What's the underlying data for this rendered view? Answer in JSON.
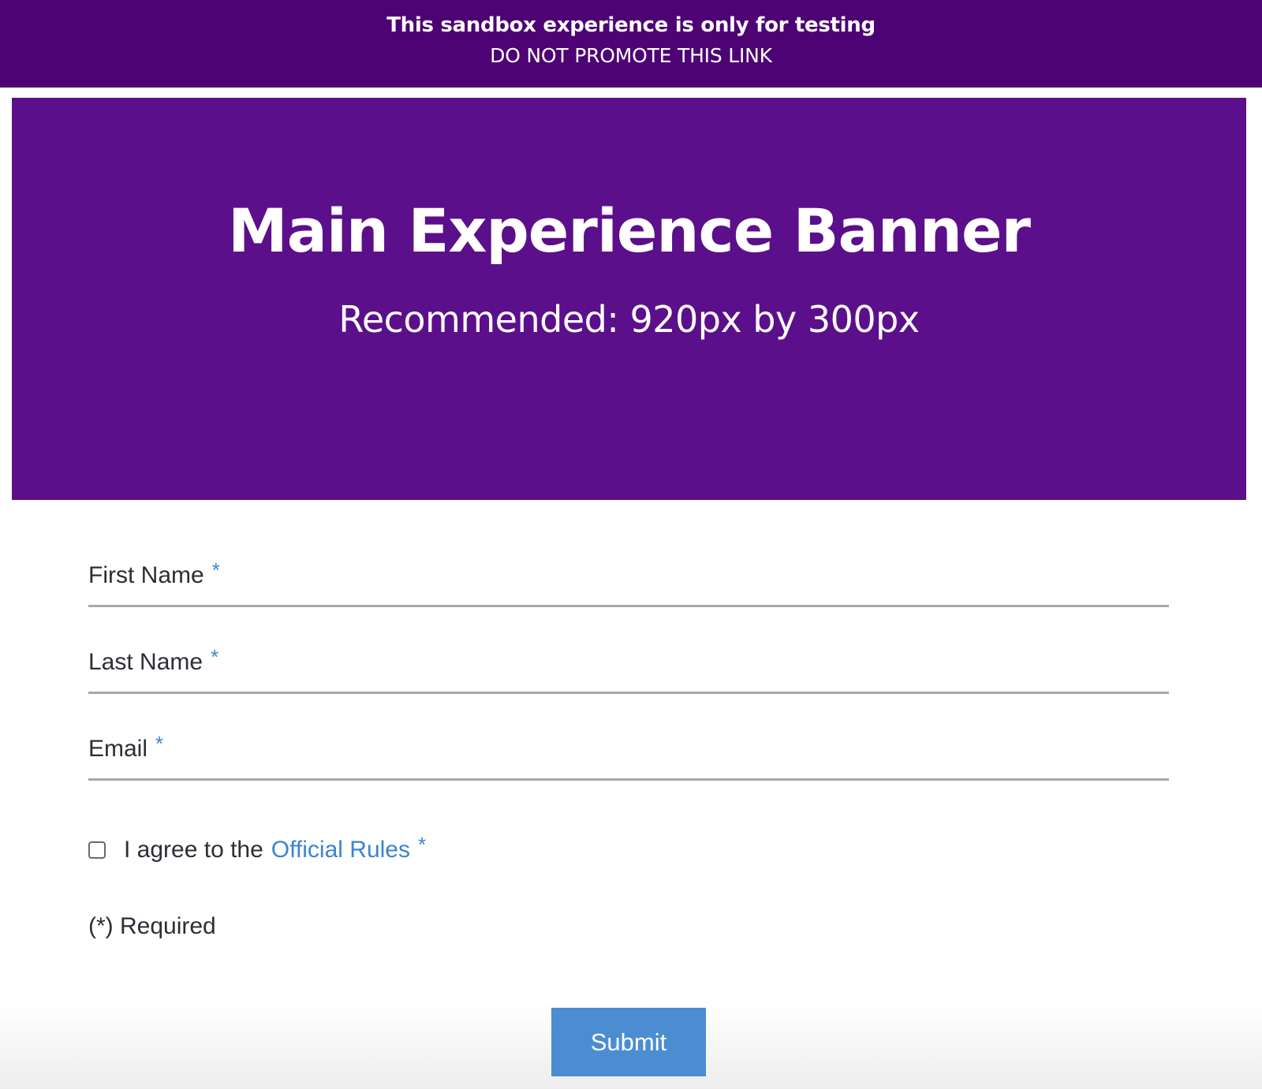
{
  "sandbox_bar": {
    "title": "This sandbox experience is only for testing",
    "subtitle": "DO NOT PROMOTE THIS LINK",
    "background": "#4e0374"
  },
  "banner": {
    "title": "Main Experience Banner",
    "subtitle": "Recommended: 920px by 300px",
    "background": "#5c0f8a"
  },
  "form": {
    "fields": [
      {
        "label": "First Name",
        "required_marker": "*",
        "value": ""
      },
      {
        "label": "Last Name",
        "required_marker": "*",
        "value": ""
      },
      {
        "label": "Email",
        "required_marker": "*",
        "value": ""
      }
    ],
    "agree": {
      "text": "I agree to the",
      "link_text": "Official Rules",
      "required_marker": "*",
      "checked": false
    },
    "required_note": "(*) Required",
    "submit_label": "Submit"
  },
  "colors": {
    "accent": "#3d84cf",
    "button": "#4b8dd1",
    "text": "#2c2e36",
    "underline": "#a7a8ab"
  }
}
